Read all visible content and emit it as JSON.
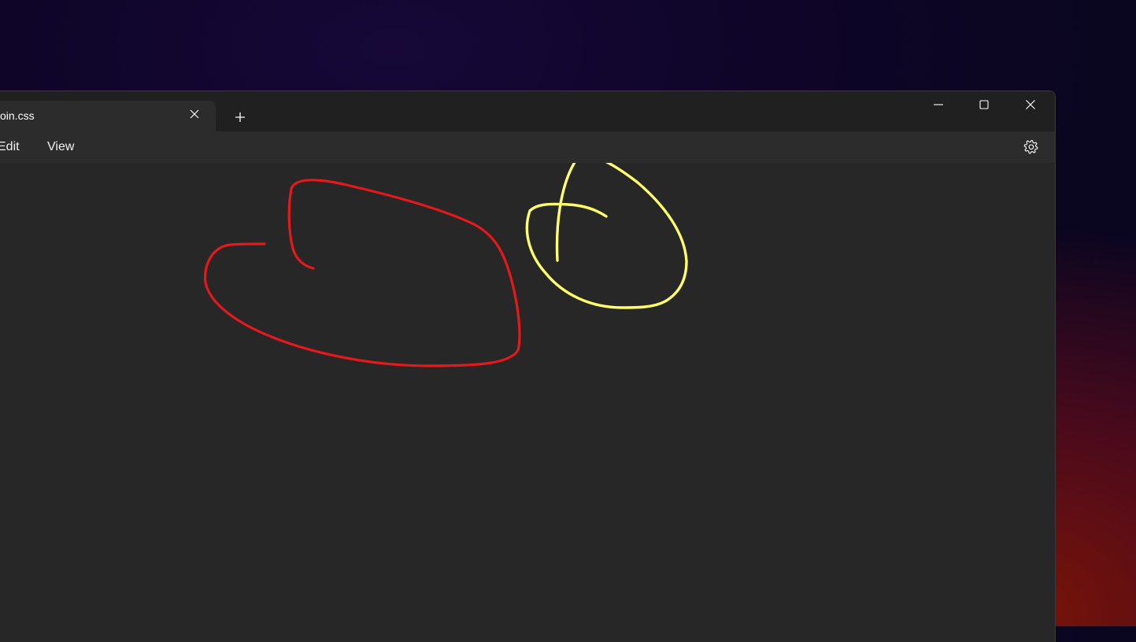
{
  "window": {
    "tab": {
      "title": "oin.css",
      "close_icon": "close-icon"
    },
    "new_tab_icon": "plus-icon",
    "controls": [
      "minimize-icon",
      "maximize-icon",
      "close-icon"
    ]
  },
  "menu": {
    "items": [
      {
        "label": "Edit"
      },
      {
        "label": "View"
      }
    ],
    "settings_icon": "gear-icon"
  },
  "drawing": {
    "strokes": [
      {
        "name": "red-ink-stroke",
        "color": "#e3191b"
      },
      {
        "name": "yellow-ink-stroke",
        "color": "#ffff6b"
      }
    ]
  },
  "colors": {
    "window_bg": "#272727",
    "titlebar_bg": "#202020",
    "text": "#ffffff"
  }
}
